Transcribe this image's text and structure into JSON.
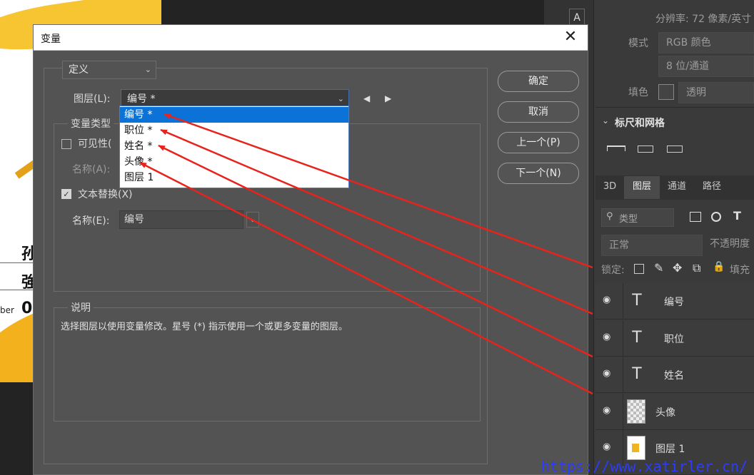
{
  "canvas": {
    "text_row1": "孙",
    "text_row2": "強",
    "text_row3": "0",
    "label_row3": "ber"
  },
  "properties_panel": {
    "resolution_text": "分辨率: 72 像素/英寸",
    "mode_label": "模式",
    "mode_value": "RGB 颜色",
    "depth_value": "8 位/通道",
    "fill_label": "填色",
    "fill_value": "透明",
    "rulers_section": "标尺和网格",
    "tool_letter": "A"
  },
  "layers_panel": {
    "tabs": [
      {
        "label": "3D"
      },
      {
        "label": "图层"
      },
      {
        "label": "通道"
      },
      {
        "label": "路径"
      }
    ],
    "filter_placeholder": "类型",
    "blend_mode": "正常",
    "opacity_label": "不透明度",
    "lock_label": "锁定:",
    "fill_label": "填充",
    "layers": [
      {
        "name": "编号",
        "kind": "text",
        "thumb": "T"
      },
      {
        "name": "职位",
        "kind": "text",
        "thumb": "T"
      },
      {
        "name": "姓名",
        "kind": "text",
        "thumb": "T"
      },
      {
        "name": "头像",
        "kind": "image",
        "thumb": ""
      },
      {
        "name": "图层 1",
        "kind": "image",
        "thumb": ""
      }
    ]
  },
  "dialog": {
    "title": "变量",
    "close_glyph": "✕",
    "mode_dropdown": "定义",
    "layer_label": "图层(L):",
    "layer_value": "编号 *",
    "layer_options": [
      "编号 *",
      "职位 *",
      "姓名 *",
      "头像 *",
      "图层 1"
    ],
    "var_type_group": "变量类型",
    "visibility_label": "可见性(",
    "visibility_name_label": "名称(A):",
    "text_replace_label": "文本替换(X)",
    "text_replace_name_label": "名称(E):",
    "text_replace_name_value": "编号",
    "description_group": "说明",
    "description_text": "选择图层以使用变量修改。星号 (*) 指示使用一个或更多变量的图层。",
    "buttons": {
      "ok": "确定",
      "cancel": "取消",
      "prev": "上一个(P)",
      "next": "下一个(N)"
    }
  },
  "watermark": "https://www.xatirler.cn/",
  "colors": {
    "dialog_bg": "#535353",
    "list_selected": "#0b73d8",
    "annotation_arrow": "#e8231c",
    "watermark": "#2a3cff"
  }
}
